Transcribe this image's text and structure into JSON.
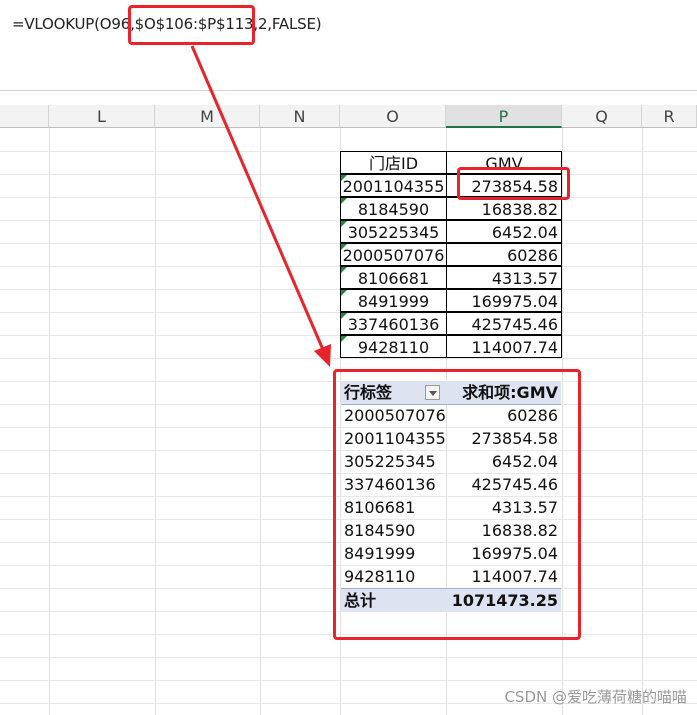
{
  "formula_bar": {
    "formula": "=VLOOKUP(O96,$O$106:$P$113,2,FALSE)"
  },
  "columns": [
    "L",
    "M",
    "N",
    "O",
    "P",
    "Q",
    "R"
  ],
  "selected_column": "P",
  "source_table": {
    "headers": [
      "门店ID",
      "GMV"
    ],
    "rows": [
      [
        "2001104355",
        "273854.58"
      ],
      [
        "8184590",
        "16838.82"
      ],
      [
        "305225345",
        "6452.04"
      ],
      [
        "2000507076",
        "60286"
      ],
      [
        "8106681",
        "4313.57"
      ],
      [
        "8491999",
        "169975.04"
      ],
      [
        "337460136",
        "425745.46"
      ],
      [
        "9428110",
        "114007.74"
      ]
    ]
  },
  "pivot_table": {
    "row_label_header": "行标签",
    "value_header": "求和项:GMV",
    "rows": [
      [
        "2000507076",
        "60286"
      ],
      [
        "2001104355",
        "273854.58"
      ],
      [
        "305225345",
        "6452.04"
      ],
      [
        "337460136",
        "425745.46"
      ],
      [
        "8106681",
        "4313.57"
      ],
      [
        "8184590",
        "16838.82"
      ],
      [
        "8491999",
        "169975.04"
      ],
      [
        "9428110",
        "114007.74"
      ]
    ],
    "total_label": "总计",
    "total_value": "1071473.25"
  },
  "watermark": "CSDN @爱吃薄荷糖的喵喵",
  "colors": {
    "annotation_red": "#e8232a",
    "pivot_header_bg": "#dde3f0",
    "selected_column_green": "#217346"
  }
}
